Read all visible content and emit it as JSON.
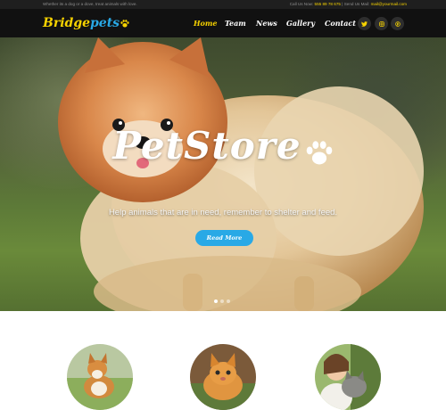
{
  "topbar": {
    "tagline": "Whether its a dog or a dove, treat animals with love.",
    "call_label": "Call Us Now:",
    "phone": "555 89 78 675",
    "separator": "|",
    "mail_label": "Send Us Mail:",
    "email": "mail@yourmail.com"
  },
  "logo": {
    "part1": "Bridge",
    "part2": "pets",
    "icon": "paw-icon"
  },
  "nav": {
    "items": [
      {
        "label": "Home",
        "active": true
      },
      {
        "label": "Team",
        "active": false
      },
      {
        "label": "News",
        "active": false
      },
      {
        "label": "Gallery",
        "active": false
      },
      {
        "label": "Contact",
        "active": false
      }
    ],
    "social": [
      "twitter-icon",
      "instagram-icon",
      "pinterest-icon"
    ]
  },
  "hero": {
    "title": "PetStore",
    "title_icon": "paw-icon",
    "subtitle": "Help animals that are in need, remember to shelter and feed.",
    "button_label": "Read More",
    "slide_count": 3,
    "active_slide": 1
  },
  "colors": {
    "accent_yellow": "#f6d200",
    "accent_blue": "#29a9e6",
    "nav_bg": "#111111",
    "topbar_bg": "#1f1f1f"
  },
  "features": [
    "corgi-photo",
    "kitten-photo",
    "girl-with-cat-photo"
  ]
}
